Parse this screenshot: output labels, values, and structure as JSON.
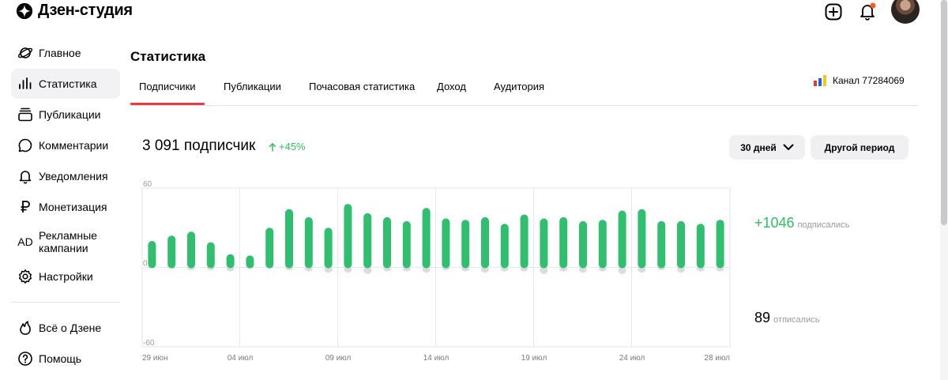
{
  "header": {
    "logo_text": "Дзен-студия"
  },
  "sidebar": {
    "items": [
      {
        "label": "Главное",
        "icon": "planet-icon"
      },
      {
        "label": "Статистика",
        "icon": "bars-icon",
        "active": true
      },
      {
        "label": "Публикации",
        "icon": "stack-icon"
      },
      {
        "label": "Комментарии",
        "icon": "comment-icon"
      },
      {
        "label": "Уведомления",
        "icon": "bell-icon"
      },
      {
        "label": "Монетизация",
        "icon": "ruble-icon"
      },
      {
        "label": "Рекламные кампании",
        "icon": "ad-icon",
        "icon_text": "AD"
      },
      {
        "label": "Настройки",
        "icon": "gear-icon"
      }
    ],
    "bottom_items": [
      {
        "label": "Всё о Дзене",
        "icon": "flame-icon"
      },
      {
        "label": "Помощь",
        "icon": "help-icon"
      }
    ]
  },
  "page": {
    "title": "Статистика",
    "tabs": [
      "Подписчики",
      "Публикации",
      "Почасовая статистика",
      "Доход",
      "Аудитория"
    ],
    "active_tab": 0,
    "channel": "Канал 77284069"
  },
  "summary": {
    "subscribers": "3 091 подписчик",
    "growth": "+45%",
    "period_selected": "30 дней",
    "period_other": "Другой период",
    "subscribed_value": "+1046",
    "subscribed_label": "подписались",
    "unsubscribed_value": "89",
    "unsubscribed_label": "отписались"
  },
  "colors": {
    "accent_green": "#2fbf5f",
    "bar_green": "#2fbf6e",
    "bar_negative": "#dcdce0",
    "tab_underline": "#f0393d"
  },
  "chart_data": {
    "type": "bar",
    "ylim": [
      -60,
      60
    ],
    "y_ticks": [
      "60",
      "0",
      "-60"
    ],
    "x_ticks": [
      "29 июн",
      "04 июл",
      "09 июл",
      "14 июл",
      "19 июл",
      "24 июл",
      "28 июл"
    ],
    "x_tick_index": [
      0,
      5,
      10,
      15,
      20,
      25,
      29
    ],
    "series": [
      {
        "values": [
          20,
          24,
          27,
          19,
          10,
          9,
          30,
          44,
          38,
          30,
          48,
          41,
          38,
          35,
          45,
          37,
          36,
          38,
          33,
          40,
          37,
          38,
          35,
          36,
          43,
          44,
          35,
          35,
          33,
          36
        ]
      },
      {
        "values": [
          0,
          -1,
          -2,
          -2,
          -3,
          -1,
          -1,
          -2,
          -3,
          -4,
          -4,
          -5,
          -3,
          -3,
          -4,
          -2,
          -3,
          -4,
          -3,
          -3,
          -5,
          -3,
          -4,
          -3,
          -5,
          -4,
          -2,
          -4,
          -3,
          -3
        ]
      }
    ],
    "positive_values": [
      20,
      24,
      27,
      19,
      10,
      9,
      30,
      44,
      38,
      30,
      48,
      41,
      38,
      35,
      45,
      37,
      36,
      38,
      33,
      40,
      37,
      38,
      35,
      36,
      43,
      44,
      35,
      35,
      33,
      36
    ],
    "negative_values": [
      0,
      -1,
      -2,
      -2,
      -3,
      -1,
      -1,
      -2,
      -3,
      -4,
      -4,
      -5,
      -3,
      -3,
      -4,
      -2,
      -3,
      -4,
      -3,
      -3,
      -5,
      -3,
      -4,
      -3,
      -5,
      -4,
      -2,
      -4,
      -3,
      -3
    ]
  }
}
